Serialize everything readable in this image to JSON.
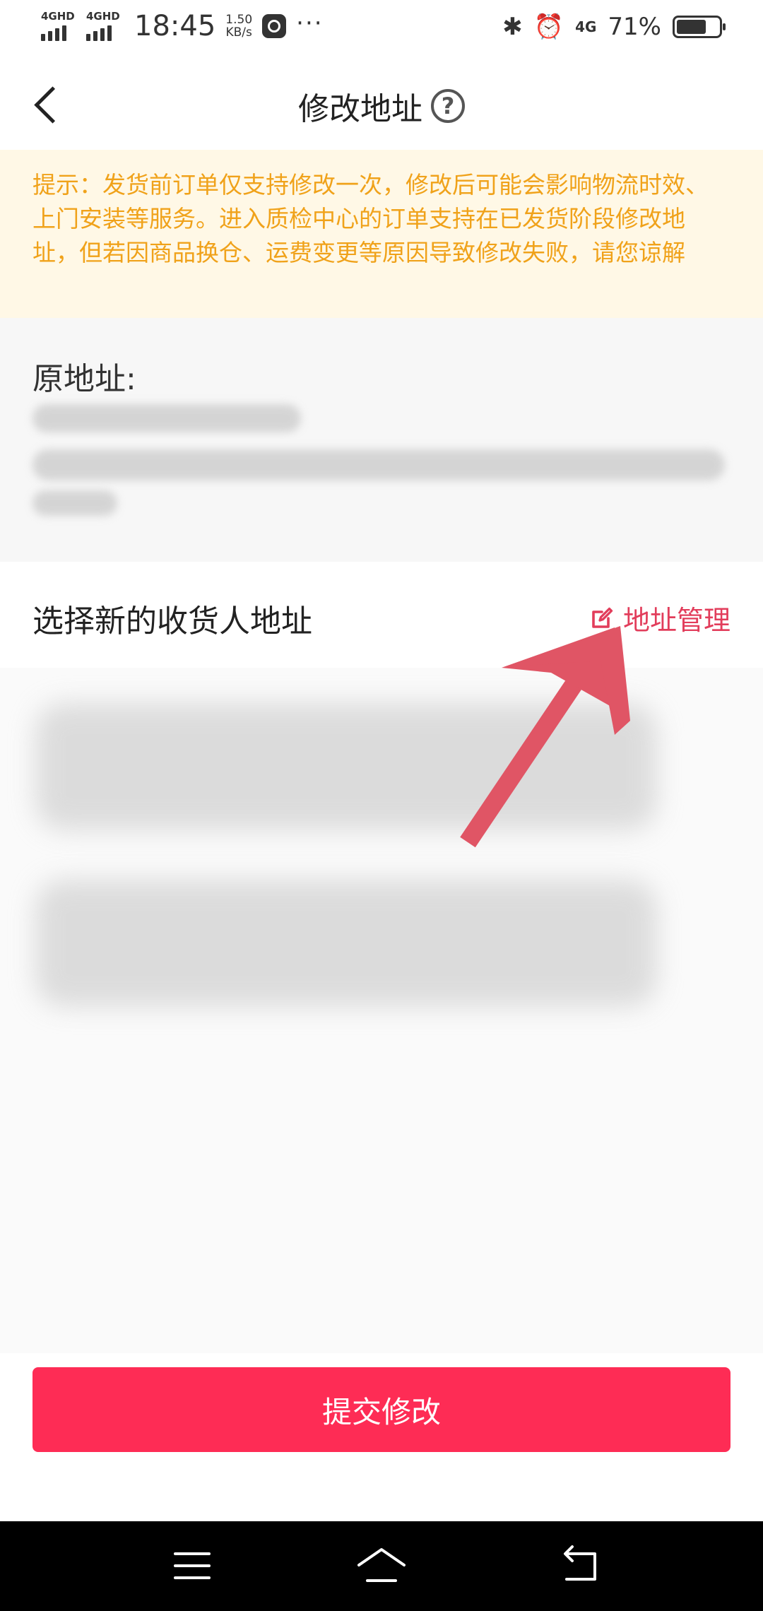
{
  "status_bar": {
    "signal1": "4GHD",
    "signal2": "4GHD",
    "time": "18:45",
    "speed_value": "1.50",
    "speed_unit": "KB/s",
    "dots": "···",
    "net": "4G",
    "battery_text": "71%",
    "battery_level": 0.71
  },
  "nav": {
    "title": "修改地址",
    "help_symbol": "?"
  },
  "notice": {
    "text": "提示：发货前订单仅支持修改一次，修改后可能会影响物流时效、上门安装等服务。进入质检中心的订单支持在已发货阶段修改地址，但若因商品换仓、运费变更等原因导致修改失败，请您谅解"
  },
  "original": {
    "label": "原地址:"
  },
  "select": {
    "title": "选择新的收货人地址",
    "manage_label": "地址管理"
  },
  "submit": {
    "label": "提交修改"
  },
  "colors": {
    "accent": "#fe2c55",
    "link": "#e23d5b",
    "notice_text": "#f0a21a",
    "notice_bg": "#fff8e6"
  }
}
